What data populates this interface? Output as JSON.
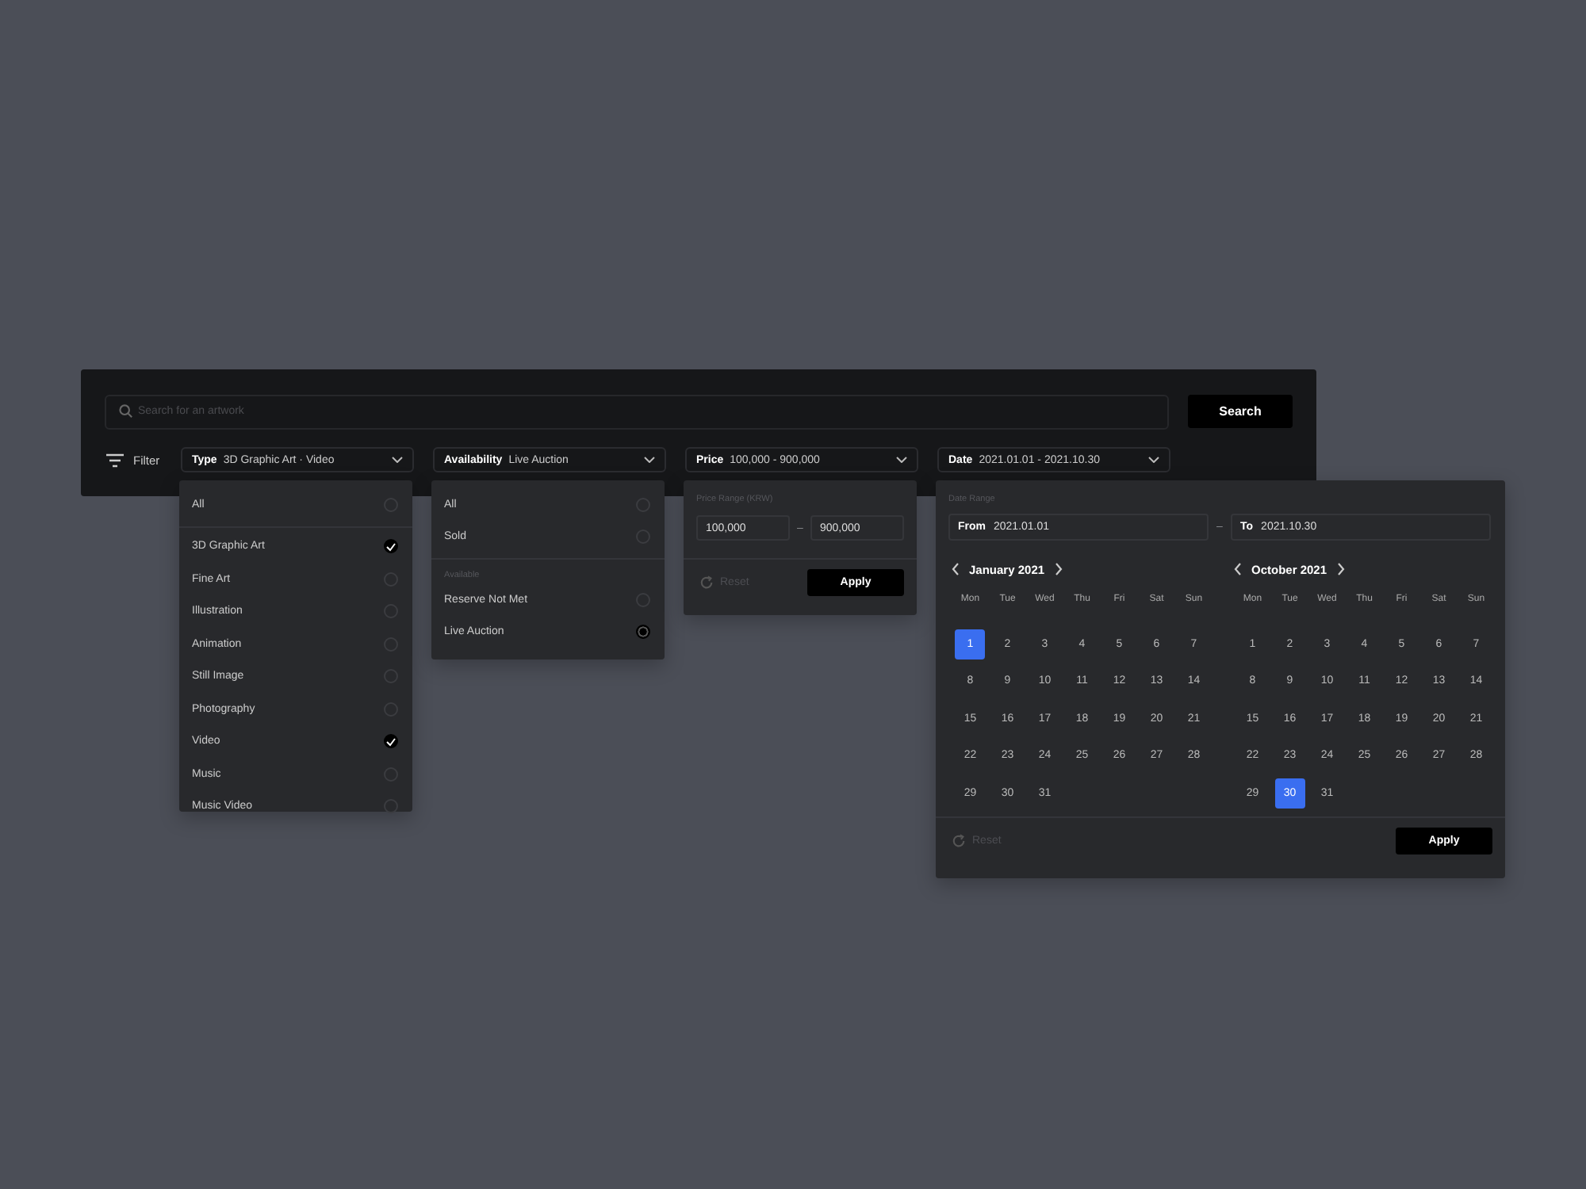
{
  "search": {
    "placeholder": "Search for an artwork",
    "button": "Search"
  },
  "filter_label": "Filter",
  "filters": [
    {
      "label": "Type",
      "value": "3D Graphic Art · Video"
    },
    {
      "label": "Availability",
      "value": "Live Auction"
    },
    {
      "label": "Price",
      "value": "100,000 - 900,000"
    },
    {
      "label": "Date",
      "value": "2021.01.01 - 2021.10.30"
    }
  ],
  "type_menu": {
    "all": {
      "label": "All",
      "checked": false
    },
    "items": [
      {
        "label": "3D Graphic Art",
        "checked": true
      },
      {
        "label": "Fine Art",
        "checked": false
      },
      {
        "label": "Illustration",
        "checked": false
      },
      {
        "label": "Animation",
        "checked": false
      },
      {
        "label": "Still Image",
        "checked": false
      },
      {
        "label": "Photography",
        "checked": false
      },
      {
        "label": "Video",
        "checked": true
      },
      {
        "label": "Music",
        "checked": false
      },
      {
        "label": "Music Video",
        "checked": false
      }
    ]
  },
  "availability_menu": {
    "items": [
      {
        "label": "All",
        "selected": false
      },
      {
        "label": "Sold",
        "selected": false
      }
    ],
    "section": "Available",
    "section_items": [
      {
        "label": "Reserve Not Met",
        "selected": false
      },
      {
        "label": "Live Auction",
        "selected": true
      }
    ]
  },
  "price_menu": {
    "label": "Price Range (KRW)",
    "min": "100,000",
    "separator": "–",
    "max": "900,000",
    "reset": "Reset",
    "apply": "Apply"
  },
  "date_menu": {
    "label": "Date Range",
    "from_label": "From",
    "from": "2021.01.01",
    "separator": "–",
    "to_label": "To",
    "to": "2021.10.30",
    "reset": "Reset",
    "apply": "Apply",
    "months": [
      {
        "title": "January 2021",
        "weekdays": [
          "Mon",
          "Tue",
          "Wed",
          "Thu",
          "Fri",
          "Sat",
          "Sun"
        ],
        "days": [
          {
            "label": "1",
            "selected": true
          },
          {
            "label": "2",
            "selected": false
          },
          {
            "label": "3",
            "selected": false
          },
          {
            "label": "4",
            "selected": false
          },
          {
            "label": "5",
            "selected": false
          },
          {
            "label": "6",
            "selected": false
          },
          {
            "label": "7",
            "selected": false
          },
          {
            "label": "8",
            "selected": false
          },
          {
            "label": "9",
            "selected": false
          },
          {
            "label": "10",
            "selected": false
          },
          {
            "label": "11",
            "selected": false
          },
          {
            "label": "12",
            "selected": false
          },
          {
            "label": "13",
            "selected": false
          },
          {
            "label": "14",
            "selected": false
          },
          {
            "label": "15",
            "selected": false
          },
          {
            "label": "16",
            "selected": false
          },
          {
            "label": "17",
            "selected": false
          },
          {
            "label": "18",
            "selected": false
          },
          {
            "label": "19",
            "selected": false
          },
          {
            "label": "20",
            "selected": false
          },
          {
            "label": "21",
            "selected": false
          },
          {
            "label": "22",
            "selected": false
          },
          {
            "label": "23",
            "selected": false
          },
          {
            "label": "24",
            "selected": false
          },
          {
            "label": "25",
            "selected": false
          },
          {
            "label": "26",
            "selected": false
          },
          {
            "label": "27",
            "selected": false
          },
          {
            "label": "28",
            "selected": false
          },
          {
            "label": "29",
            "selected": false
          },
          {
            "label": "30",
            "selected": false
          },
          {
            "label": "31",
            "selected": false
          }
        ]
      },
      {
        "title": "October 2021",
        "weekdays": [
          "Mon",
          "Tue",
          "Wed",
          "Thu",
          "Fri",
          "Sat",
          "Sun"
        ],
        "days": [
          {
            "label": "1",
            "selected": false
          },
          {
            "label": "2",
            "selected": false
          },
          {
            "label": "3",
            "selected": false
          },
          {
            "label": "4",
            "selected": false
          },
          {
            "label": "5",
            "selected": false
          },
          {
            "label": "6",
            "selected": false
          },
          {
            "label": "7",
            "selected": false
          },
          {
            "label": "8",
            "selected": false
          },
          {
            "label": "9",
            "selected": false
          },
          {
            "label": "10",
            "selected": false
          },
          {
            "label": "11",
            "selected": false
          },
          {
            "label": "12",
            "selected": false
          },
          {
            "label": "13",
            "selected": false
          },
          {
            "label": "14",
            "selected": false
          },
          {
            "label": "15",
            "selected": false
          },
          {
            "label": "16",
            "selected": false
          },
          {
            "label": "17",
            "selected": false
          },
          {
            "label": "18",
            "selected": false
          },
          {
            "label": "19",
            "selected": false
          },
          {
            "label": "20",
            "selected": false
          },
          {
            "label": "21",
            "selected": false
          },
          {
            "label": "22",
            "selected": false
          },
          {
            "label": "23",
            "selected": false
          },
          {
            "label": "24",
            "selected": false
          },
          {
            "label": "25",
            "selected": false
          },
          {
            "label": "26",
            "selected": false
          },
          {
            "label": "27",
            "selected": false
          },
          {
            "label": "28",
            "selected": false
          },
          {
            "label": "29",
            "selected": false
          },
          {
            "label": "30",
            "selected": true
          },
          {
            "label": "31",
            "selected": false
          }
        ]
      }
    ]
  }
}
